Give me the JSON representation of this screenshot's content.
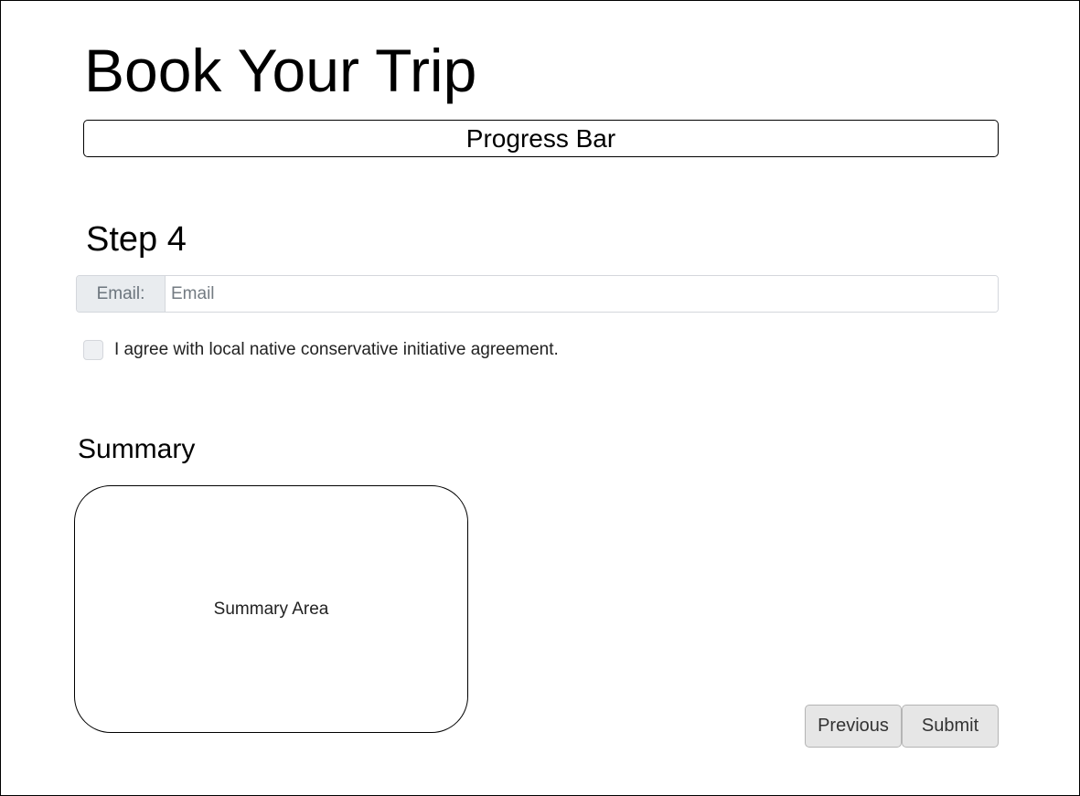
{
  "page": {
    "title": "Book Your Trip"
  },
  "progress": {
    "label": "Progress Bar"
  },
  "step": {
    "title": "Step 4"
  },
  "email": {
    "label": "Email:",
    "placeholder": "Email",
    "value": ""
  },
  "agreement": {
    "label": "I agree with local native conservative initiative agreement.",
    "checked": false
  },
  "summary": {
    "heading": "Summary",
    "area_label": "Summary Area"
  },
  "buttons": {
    "previous_label": "Previous",
    "submit_label": "Submit"
  }
}
